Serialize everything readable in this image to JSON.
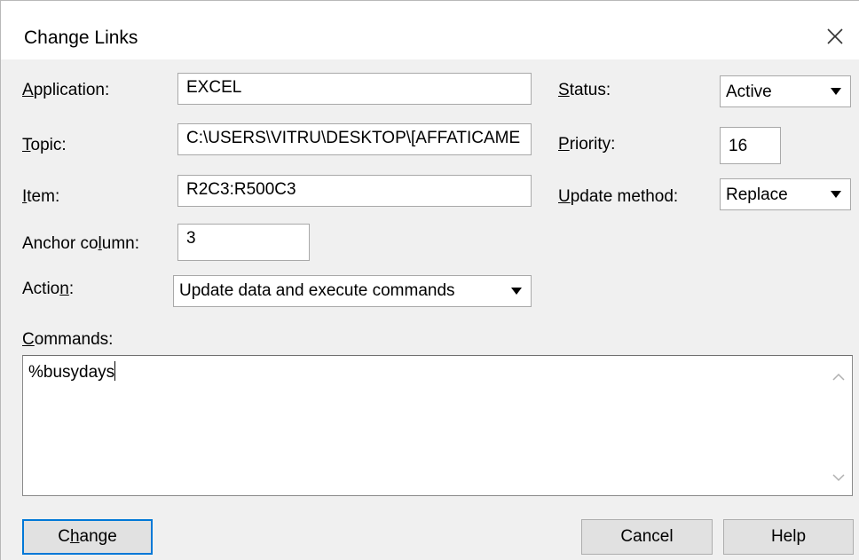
{
  "window": {
    "title": "Change Links"
  },
  "fields": {
    "application": {
      "label_mn": "A",
      "label_rest": "pplication:",
      "value": "EXCEL"
    },
    "topic": {
      "label_mn": "T",
      "label_rest": "opic:",
      "value": "C:\\USERS\\VITRU\\DESKTOP\\[AFFATICAME"
    },
    "item": {
      "label_pre": "",
      "label_mn": "I",
      "label_rest": "tem:",
      "value": "R2C3:R500C3"
    },
    "anchor_column": {
      "label_pre": "Anchor co",
      "label_mn": "l",
      "label_rest": "umn:",
      "value": "3"
    },
    "action": {
      "label_pre": "Actio",
      "label_mn": "n",
      "label_rest": ":",
      "value": "Update data and execute commands"
    },
    "status": {
      "label_mn": "S",
      "label_rest": "tatus:",
      "value": "Active"
    },
    "priority": {
      "label_mn": "P",
      "label_rest": "riority:",
      "value": "16"
    },
    "update_method": {
      "label_mn": "U",
      "label_rest": "pdate method:",
      "value": "Replace"
    },
    "commands": {
      "label_mn": "C",
      "label_rest": "ommands:",
      "value": "%busydays"
    }
  },
  "buttons": {
    "change": {
      "pre": "C",
      "mn": "h",
      "rest": "ange"
    },
    "cancel": "Cancel",
    "help": "Help"
  },
  "icons": {
    "close": "close-icon",
    "dropdown": "chevron-down-icon",
    "scroll_up": "scroll-up-arrow-icon",
    "scroll_down": "scroll-down-arrow-icon"
  },
  "colors": {
    "dialog_bg": "#f0f0f0",
    "default_button_border": "#0078d7"
  }
}
